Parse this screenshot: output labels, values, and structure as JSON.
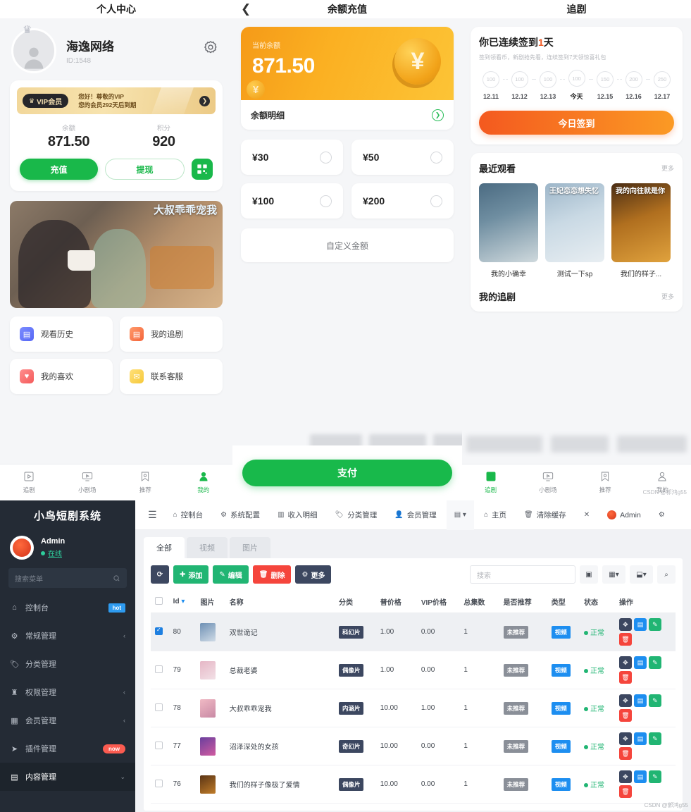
{
  "phone1": {
    "title": "个人中心",
    "user": {
      "name": "海逸网络",
      "id": "ID:1548"
    },
    "vip": {
      "pill": "VIP会员",
      "line1": "您好！尊敬的VIP",
      "line2": "您的会员292天后到期"
    },
    "stats": [
      {
        "label": "余额",
        "value": "871.50"
      },
      {
        "label": "积分",
        "value": "920"
      }
    ],
    "actions": {
      "recharge": "充值",
      "withdraw": "提现"
    },
    "banner_title": "大叔乖乖宠我",
    "menu": [
      {
        "label": "观看历史",
        "icon": "history-icon"
      },
      {
        "label": "我的追剧",
        "icon": "follow-icon"
      },
      {
        "label": "我的喜欢",
        "icon": "heart-icon"
      },
      {
        "label": "联系客服",
        "icon": "service-icon"
      }
    ],
    "tabbar": [
      {
        "label": "追剧",
        "icon": "play-box-icon"
      },
      {
        "label": "小剧场",
        "icon": "tv-icon"
      },
      {
        "label": "推荐",
        "icon": "bookmark-icon"
      },
      {
        "label": "我的",
        "icon": "person-icon"
      }
    ],
    "active_tab": "我的"
  },
  "phone2": {
    "title": "余额充值",
    "balance_label": "当前余额",
    "balance_value": "871.50",
    "detail_label": "余额明细",
    "amounts": [
      "¥30",
      "¥50",
      "¥100",
      "¥200"
    ],
    "custom_label": "自定义金额",
    "pay_label": "支付"
  },
  "phone3": {
    "title": "追剧",
    "signin": {
      "title_prefix": "你已连续签到",
      "title_num": "1",
      "title_suffix": "天",
      "subtitle": "签到领看币，新剧抢先看，连续签到7天领惊喜礼包",
      "days": [
        {
          "coins": "100",
          "date": "12.11"
        },
        {
          "coins": "100",
          "date": "12.12"
        },
        {
          "coins": "100",
          "date": "12.13"
        },
        {
          "coins": "100",
          "date": "今天"
        },
        {
          "coins": "150",
          "date": "12.15"
        },
        {
          "coins": "200",
          "date": "12.16"
        },
        {
          "coins": "250",
          "date": "12.17"
        }
      ],
      "button": "今日签到"
    },
    "recent": {
      "heading": "最近观看",
      "more": "更多",
      "items": [
        {
          "caption": "我的小确幸",
          "poster_text": ""
        },
        {
          "caption": "测试一下sp",
          "poster_text": "王妃恋恋想失忆"
        },
        {
          "caption": "我们的样子...",
          "poster_text": "我的向往就是你"
        }
      ]
    },
    "my_follow": {
      "heading": "我的追剧",
      "more": "更多"
    },
    "tabbar": [
      {
        "label": "追剧",
        "icon": "play-box-icon"
      },
      {
        "label": "小剧场",
        "icon": "tv-icon"
      },
      {
        "label": "推荐",
        "icon": "bookmark-icon"
      },
      {
        "label": "我的",
        "icon": "person-icon"
      }
    ],
    "active_tab": "追剧",
    "watermark": "CSDN @郭鸿g55"
  },
  "admin": {
    "logo": "小鸟短剧系统",
    "user": {
      "name": "Admin",
      "status": "在线"
    },
    "sidebar_search_placeholder": "搜索菜单",
    "sidebar": [
      {
        "label": "控制台",
        "icon": "dashboard-icon",
        "badge": "hot",
        "badge_type": "hot",
        "arrow": ""
      },
      {
        "label": "常规管理",
        "icon": "settings-icon",
        "badge": "",
        "badge_type": "",
        "arrow": "‹"
      },
      {
        "label": "分类管理",
        "icon": "tag-icon",
        "badge": "",
        "badge_type": "",
        "arrow": ""
      },
      {
        "label": "权限管理",
        "icon": "shield-icon",
        "badge": "",
        "badge_type": "",
        "arrow": "‹"
      },
      {
        "label": "会员管理",
        "icon": "users-icon",
        "badge": "",
        "badge_type": "",
        "arrow": "‹"
      },
      {
        "label": "插件管理",
        "icon": "plugin-icon",
        "badge": "now",
        "badge_type": "new",
        "arrow": ""
      },
      {
        "label": "内容管理",
        "icon": "content-icon",
        "badge": "",
        "badge_type": "",
        "arrow": "⌄"
      }
    ],
    "active_sidebar": "内容管理",
    "topnav": [
      {
        "label": "控制台",
        "icon": "dashboard-icon"
      },
      {
        "label": "系统配置",
        "icon": "gear-icon"
      },
      {
        "label": "收入明细",
        "icon": "chart-icon"
      },
      {
        "label": "分类管理",
        "icon": "tag-icon"
      },
      {
        "label": "会员管理",
        "icon": "user-icon"
      },
      {
        "label": "",
        "icon": "list-dropdown-icon"
      },
      {
        "label": "主页",
        "icon": "home-icon"
      },
      {
        "label": "清除缓存",
        "icon": "trash-icon"
      },
      {
        "label": "",
        "icon": "fullscreen-icon"
      },
      {
        "label": "Admin",
        "icon": "bird-avatar-icon"
      },
      {
        "label": "",
        "icon": "gear2-icon"
      }
    ],
    "tabs": [
      {
        "label": "全部",
        "selected": true
      },
      {
        "label": "视频",
        "selected": false
      },
      {
        "label": "图片",
        "selected": false
      }
    ],
    "toolbar": {
      "refresh": "",
      "add": "添加",
      "edit": "编辑",
      "delete": "删除",
      "more": "更多",
      "search_placeholder": "搜索"
    },
    "columns": [
      "",
      "Id",
      "图片",
      "名称",
      "分类",
      "普价格",
      "VIP价格",
      "总集数",
      "是否推荐",
      "类型",
      "状态",
      "操作"
    ],
    "rows": [
      {
        "checked": true,
        "id": "80",
        "name": "双世诡记",
        "category": "科幻片",
        "price": "1.00",
        "vip_price": "0.00",
        "episodes": "1",
        "recommend": "未推荐",
        "type": "视频",
        "status": "正常"
      },
      {
        "checked": false,
        "id": "79",
        "name": "总裁老婆",
        "category": "偶像片",
        "price": "1.00",
        "vip_price": "0.00",
        "episodes": "1",
        "recommend": "未推荐",
        "type": "视频",
        "status": "正常"
      },
      {
        "checked": false,
        "id": "78",
        "name": "大叔乖乖宠我",
        "category": "内涵片",
        "price": "10.00",
        "vip_price": "1.00",
        "episodes": "1",
        "recommend": "未推荐",
        "type": "视频",
        "status": "正常"
      },
      {
        "checked": false,
        "id": "77",
        "name": "沼泽深处的女孩",
        "category": "奇幻片",
        "price": "10.00",
        "vip_price": "0.00",
        "episodes": "1",
        "recommend": "未推荐",
        "type": "视频",
        "status": "正常"
      },
      {
        "checked": false,
        "id": "76",
        "name": "我们的样子像极了爱情",
        "category": "偶像片",
        "price": "10.00",
        "vip_price": "0.00",
        "episodes": "1",
        "recommend": "未推荐",
        "type": "视频",
        "status": "正常"
      }
    ],
    "watermark": "CSDN @郭鸿g55"
  },
  "colors": {
    "green": "#19b84a",
    "orange": "#f59a18",
    "sidebar_dark": "#242b35",
    "accent_blue": "#1d8ef0",
    "danger_red": "#f5453c"
  }
}
